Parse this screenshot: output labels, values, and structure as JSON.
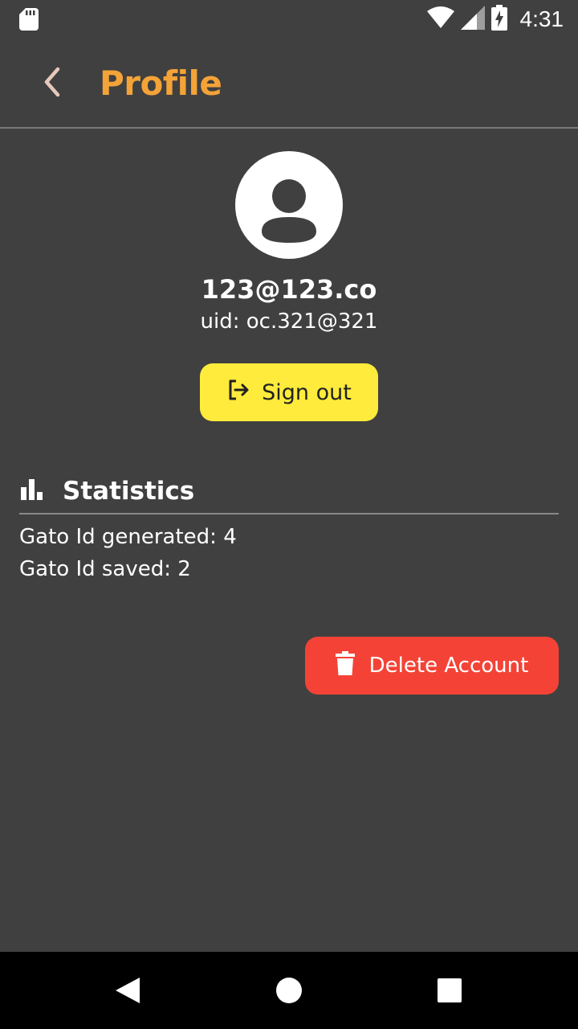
{
  "status_bar": {
    "time": "4:31",
    "icons": [
      "sd-card-icon",
      "wifi-icon",
      "signal-icon",
      "battery-charging-icon"
    ]
  },
  "app_bar": {
    "title": "Profile",
    "back_icon": "chevron-left-icon"
  },
  "profile": {
    "email": "123@123.co",
    "uid": "uid: oc.321@321",
    "avatar_icon": "account-circle-icon"
  },
  "sign_out": {
    "label": "Sign out",
    "icon": "logout-icon"
  },
  "statistics": {
    "title": "Statistics",
    "icon": "bar-chart-icon",
    "lines": [
      "Gato Id generated: 4",
      "Gato Id saved: 2"
    ]
  },
  "delete_account": {
    "label": "Delete Account",
    "icon": "trash-icon"
  },
  "colors": {
    "background": "#404040",
    "title": "#f4a338",
    "sign_out": "#ffeb3b",
    "delete": "#f44336",
    "nav_bar": "#000000"
  },
  "nav_bar": {
    "icons": [
      "nav-back-icon",
      "nav-home-icon",
      "nav-recents-icon"
    ]
  }
}
